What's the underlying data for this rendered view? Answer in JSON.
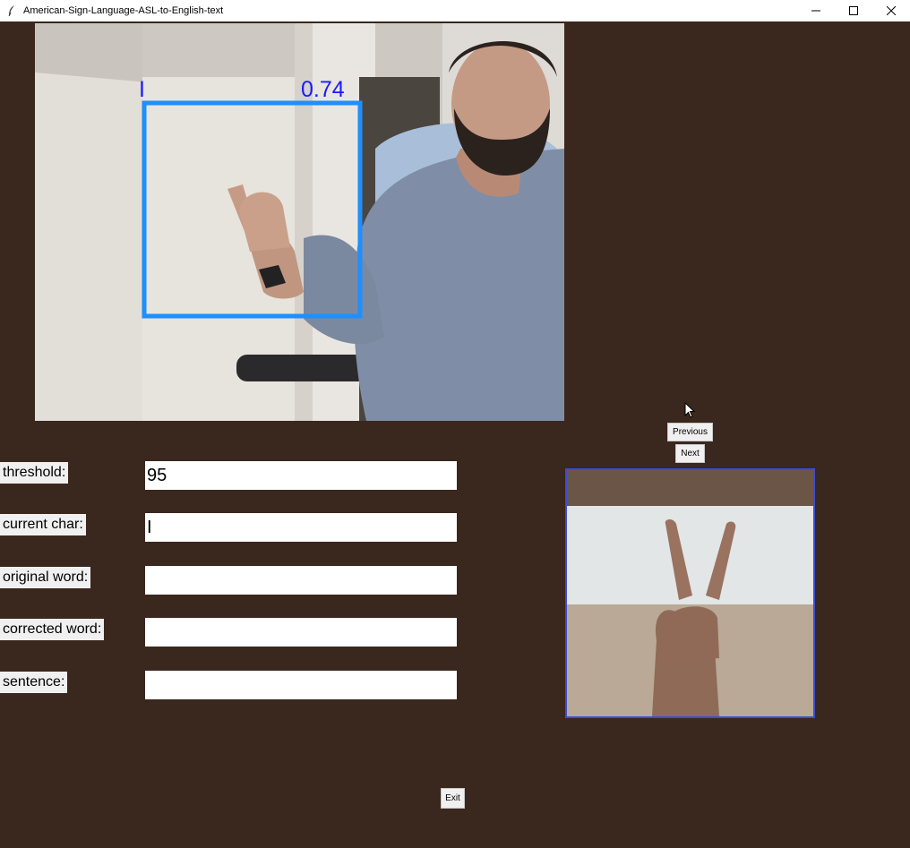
{
  "window": {
    "title": "American-Sign-Language-ASL-to-English-text",
    "icon": "feather-icon",
    "controls": [
      "minimize-icon",
      "maximize-icon",
      "close-icon"
    ]
  },
  "detection": {
    "label": "I",
    "confidence": "0.74",
    "box_color": "#1e8fff"
  },
  "fields": {
    "threshold": {
      "label": "threshold:",
      "value": "95"
    },
    "current_char": {
      "label": "current char:",
      "value": "I"
    },
    "original_word": {
      "label": "original word:",
      "value": ""
    },
    "corrected_word": {
      "label": "corrected word:",
      "value": ""
    },
    "sentence": {
      "label": "sentence:",
      "value": ""
    }
  },
  "buttons": {
    "previous": "Previous",
    "next": "Next",
    "exit": "Exit"
  },
  "colors": {
    "background": "#3a271e",
    "reference_border": "#3b4cd6"
  }
}
